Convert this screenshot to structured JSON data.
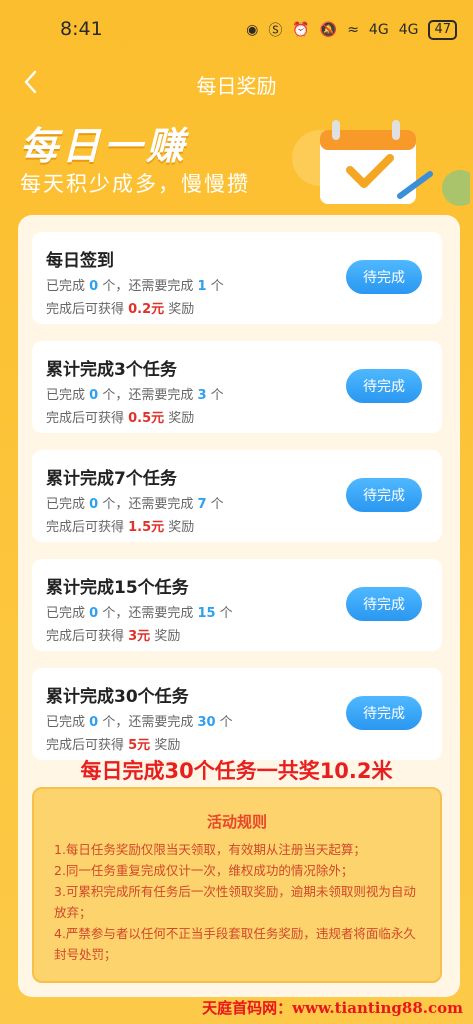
{
  "status_bar": {
    "time": "8:41",
    "network": "4G",
    "network2": "4G",
    "battery": "47"
  },
  "nav": {
    "title": "每日奖励"
  },
  "hero": {
    "title": "每日一赚",
    "subtitle": "每天积少成多，慢慢攒"
  },
  "tasks": [
    {
      "title": "每日签到",
      "p1": "已完成 ",
      "done": "0",
      "p2": " 个，还需要完成 ",
      "need": "1",
      "p3": " 个",
      "r1": "完成后可获得 ",
      "reward": "0.2元",
      "r2": " 奖励",
      "button": "待完成"
    },
    {
      "title": "累计完成3个任务",
      "p1": "已完成 ",
      "done": "0",
      "p2": " 个，还需要完成 ",
      "need": "3",
      "p3": " 个",
      "r1": "完成后可获得 ",
      "reward": "0.5元",
      "r2": " 奖励",
      "button": "待完成"
    },
    {
      "title": "累计完成7个任务",
      "p1": "已完成 ",
      "done": "0",
      "p2": " 个，还需要完成 ",
      "need": "7",
      "p3": " 个",
      "r1": "完成后可获得 ",
      "reward": "1.5元",
      "r2": " 奖励",
      "button": "待完成"
    },
    {
      "title": "累计完成15个任务",
      "p1": "已完成 ",
      "done": "0",
      "p2": " 个，还需要完成 ",
      "need": "15",
      "p3": " 个",
      "r1": "完成后可获得 ",
      "reward": "3元",
      "r2": " 奖励",
      "button": "待完成"
    },
    {
      "title": "累计完成30个任务",
      "p1": "已完成 ",
      "done": "0",
      "p2": " 个，还需要完成 ",
      "need": "30",
      "p3": " 个",
      "r1": "完成后可获得 ",
      "reward": "5元",
      "r2": " 奖励",
      "button": "待完成"
    }
  ],
  "promo": "每日完成30个任务一共奖10.2米",
  "rules": {
    "title": "活动规则",
    "items": [
      "1.每日任务奖励仅限当天领取，有效期从注册当天起算；",
      "2.同一任务重复完成仅计一次，维权成功的情况除外；",
      "3.可累积完成所有任务后一次性领取奖励，逾期未领取则视为自动放弃；",
      "4.严禁参与者以任何不正当手段套取任务奖励，违规者将面临永久封号处罚；"
    ]
  },
  "watermark": "天庭首码网：www.tianting88.com",
  "colors": {
    "background": "#FCC337",
    "button": "#2EA0F2",
    "reward": "#E0312B",
    "promo": "#E81F1F"
  }
}
